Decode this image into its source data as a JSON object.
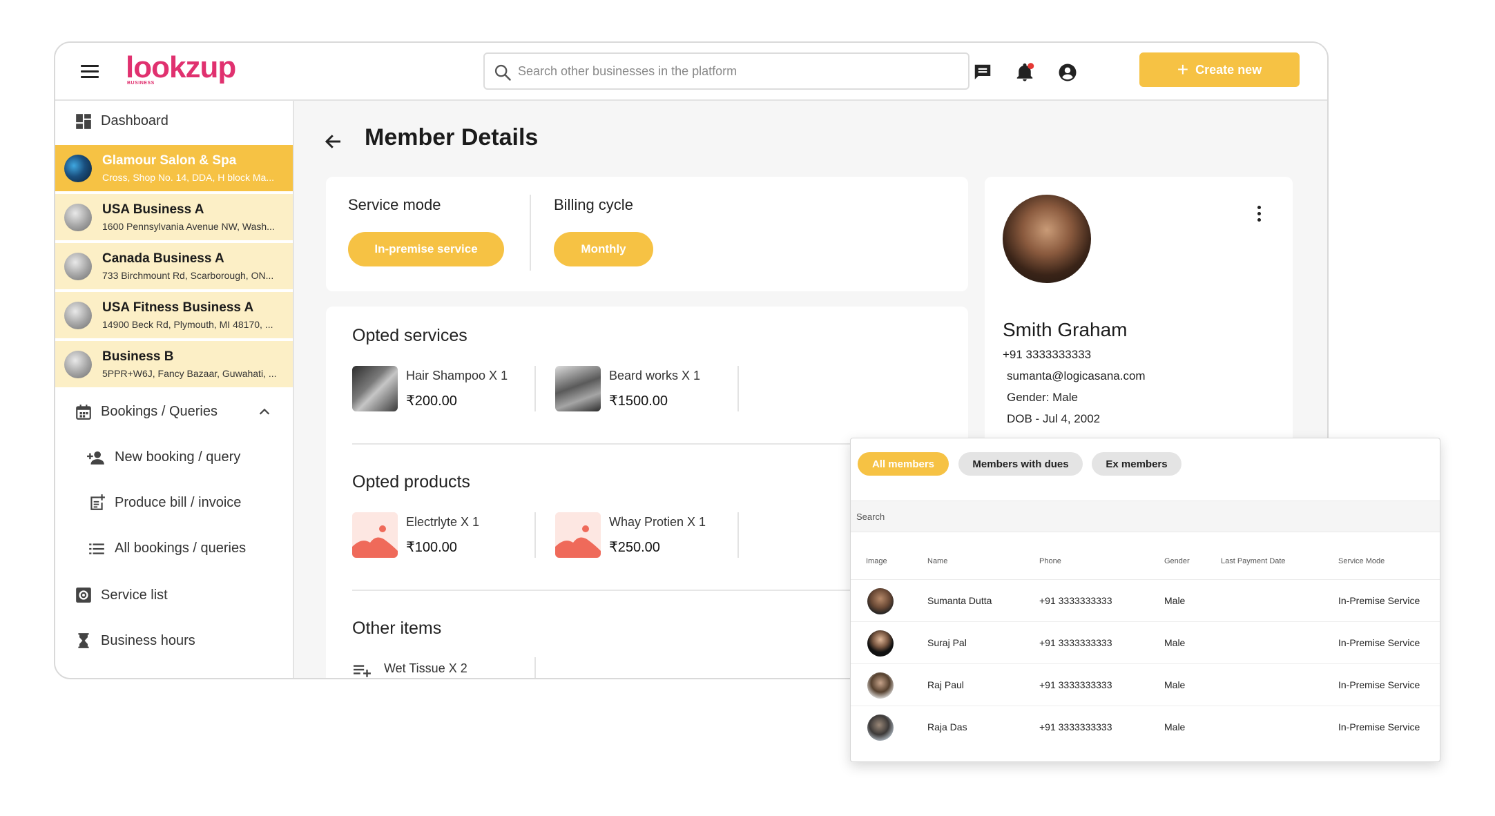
{
  "app": {
    "logo_text": "lookzup",
    "logo_sub": "BUSINESS"
  },
  "header": {
    "search_placeholder": "Search other businesses in the platform",
    "create_label": "Create new"
  },
  "sidebar": {
    "dashboard_label": "Dashboard",
    "businesses": [
      {
        "name": "Glamour Salon & Spa",
        "address": "Cross, Shop No. 14, DDA, H block Ma...",
        "active": true
      },
      {
        "name": "USA Business A",
        "address": "1600 Pennsylvania Avenue NW, Wash...",
        "active": false
      },
      {
        "name": "Canada Business A",
        "address": "733 Birchmount Rd, Scarborough, ON...",
        "active": false
      },
      {
        "name": "USA Fitness Business A",
        "address": "14900 Beck Rd, Plymouth, MI 48170, ...",
        "active": false
      },
      {
        "name": "Business B",
        "address": "5PPR+W6J, Fancy Bazaar, Guwahati, ...",
        "active": false
      }
    ],
    "bookings_label": "Bookings / Queries",
    "new_booking_label": "New booking / query",
    "produce_bill_label": "Produce bill / invoice",
    "all_bookings_label": "All bookings / queries",
    "service_list_label": "Service list",
    "business_hours_label": "Business hours"
  },
  "main": {
    "title": "Member Details",
    "service_mode": {
      "label": "Service mode",
      "value": "In-premise service"
    },
    "billing_cycle": {
      "label": "Billing cycle",
      "value": "Monthly"
    },
    "opted_services": {
      "title": "Opted services",
      "items": [
        {
          "name": "Hair Shampoo X 1",
          "price": "₹200.00"
        },
        {
          "name": "Beard works X 1",
          "price": "₹1500.00"
        }
      ]
    },
    "opted_products": {
      "title": "Opted products",
      "items": [
        {
          "name": "Electrlyte X 1",
          "price": "₹100.00"
        },
        {
          "name": "Whay Protien X 1",
          "price": "₹250.00"
        }
      ]
    },
    "other_items": {
      "title": "Other items",
      "items": [
        {
          "name": "Wet Tissue X 2"
        }
      ]
    }
  },
  "profile": {
    "name": "Smith Graham",
    "phone": "+91 3333333333",
    "email": "sumanta@logicasana.com",
    "gender": "Gender: Male",
    "dob": "DOB - Jul 4, 2002"
  },
  "members": {
    "tabs": [
      "All members",
      "Members with dues",
      "Ex members"
    ],
    "search_placeholder": "Search",
    "columns": [
      "Image",
      "Name",
      "Phone",
      "Gender",
      "Last Payment Date",
      "Service Mode"
    ],
    "rows": [
      {
        "name": "Sumanta Dutta",
        "phone": "+91 3333333333",
        "gender": "Male",
        "last_payment": "",
        "mode": "In-Premise Service"
      },
      {
        "name": "Suraj Pal",
        "phone": "+91 3333333333",
        "gender": "Male",
        "last_payment": "",
        "mode": "In-Premise Service"
      },
      {
        "name": "Raj Paul",
        "phone": "+91 3333333333",
        "gender": "Male",
        "last_payment": "",
        "mode": "In-Premise Service"
      },
      {
        "name": "Raja Das",
        "phone": "+91 3333333333",
        "gender": "Male",
        "last_payment": "",
        "mode": "In-Premise Service"
      }
    ]
  },
  "colors": {
    "accent": "#f6c244",
    "accent_light": "#fcefc6",
    "brand": "#e0316f",
    "notification_dot": "#e53935"
  }
}
